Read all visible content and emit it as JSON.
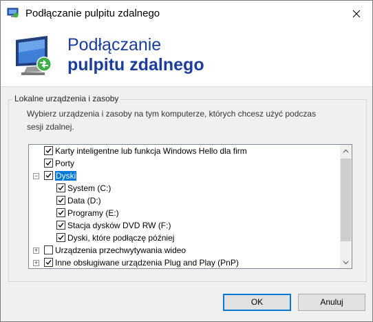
{
  "window": {
    "title": "Podłączanie pulpitu zdalnego"
  },
  "banner": {
    "line1": "Podłączanie",
    "line2": "pulpitu zdalnego"
  },
  "group": {
    "legend": "Lokalne urządzenia i zasoby",
    "description": "Wybierz urządzenia i zasoby na tym komputerze, których chcesz użyć podczas sesji zdalnej."
  },
  "tree": {
    "items": [
      {
        "label": "Karty inteligentne lub funkcja Windows Hello dla firm",
        "checked": true,
        "level": 0,
        "expander": "none",
        "selected": false
      },
      {
        "label": "Porty",
        "checked": true,
        "level": 0,
        "expander": "none",
        "selected": false
      },
      {
        "label": "Dyski",
        "checked": true,
        "level": 0,
        "expander": "collapse",
        "selected": true
      },
      {
        "label": "System (C:)",
        "checked": true,
        "level": 1,
        "expander": "none",
        "selected": false
      },
      {
        "label": "Data (D:)",
        "checked": true,
        "level": 1,
        "expander": "none",
        "selected": false
      },
      {
        "label": "Programy (E:)",
        "checked": true,
        "level": 1,
        "expander": "none",
        "selected": false
      },
      {
        "label": "Stacja dysków DVD RW (F:)",
        "checked": true,
        "level": 1,
        "expander": "none",
        "selected": false
      },
      {
        "label": "Dyski, które podłączę później",
        "checked": true,
        "level": 1,
        "expander": "none",
        "selected": false
      },
      {
        "label": "Urządzenia przechwytywania wideo",
        "checked": false,
        "level": 0,
        "expander": "expand",
        "selected": false
      },
      {
        "label": "Inne obsługiwane urządzenia Plug and Play (PnP)",
        "checked": true,
        "level": 0,
        "expander": "expand",
        "selected": false
      }
    ]
  },
  "buttons": {
    "ok": "OK",
    "cancel": "Anuluj"
  },
  "colors": {
    "accent": "#0078d7",
    "banner_text": "#1b3e9c"
  }
}
